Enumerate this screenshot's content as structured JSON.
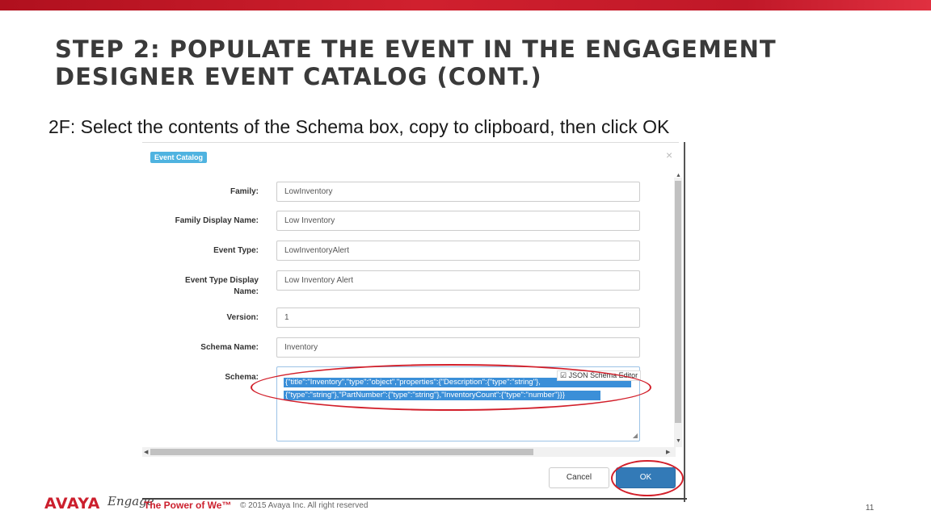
{
  "slide": {
    "title": "STEP 2: POPULATE THE EVENT IN THE ENGAGEMENT DESIGNER EVENT CATALOG (CONT.)",
    "instruction": "2F: Select the contents of the Schema box, copy to clipboard, then click OK"
  },
  "dialog": {
    "title": "Event Catalog",
    "close_icon": "×",
    "fields": [
      {
        "label": "Family:",
        "value": "LowInventory"
      },
      {
        "label": "Family Display Name:",
        "value": "Low Inventory"
      },
      {
        "label": "Event Type:",
        "value": "LowInventoryAlert"
      },
      {
        "label": "Event Type Display Name:",
        "value": "Low Inventory Alert"
      },
      {
        "label": "Version:",
        "value": "1"
      },
      {
        "label": "Schema Name:",
        "value": "Inventory"
      }
    ],
    "schema": {
      "label": "Schema:",
      "line1": "{\"title\":\"Inventory\",\"type\":\"object\",\"properties\":{\"Description\":{\"type\":\"string\"},",
      "line2": "{\"type\":\"string\"},\"PartNumber\":{\"type\":\"string\"},\"InventoryCount\":{\"type\":\"number\"}}}",
      "editor_toggle": "JSON Schema Editor",
      "editor_checked": true
    },
    "buttons": {
      "cancel": "Cancel",
      "ok": "OK"
    }
  },
  "footer": {
    "logo": "AVAYA",
    "engage": "Engage",
    "tagline": "The Power of We™",
    "copyright": "© 2015 Avaya Inc. All right reserved",
    "page_number": "11"
  },
  "colors": {
    "accent_red": "#cc1f2d",
    "ok_blue": "#337ab7",
    "selection_blue": "#3b8fd8"
  },
  "icons": [
    "close-icon",
    "checkbox-icon",
    "resize-grip-icon",
    "scroll-up-icon",
    "scroll-down-icon",
    "scroll-left-icon",
    "scroll-right-icon"
  ]
}
